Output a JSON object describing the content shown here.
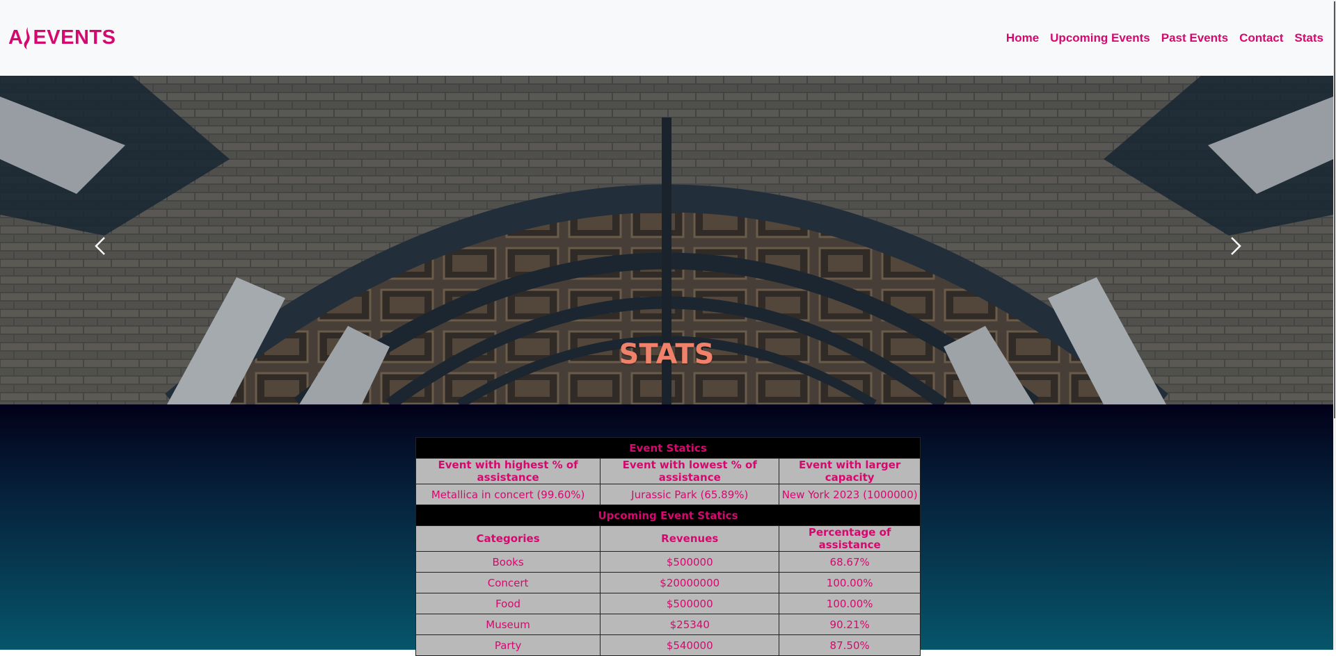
{
  "brand": {
    "name": "EVENTS",
    "logo_icon": "flame-a-icon",
    "color": "#d6086f"
  },
  "nav": {
    "items": [
      "Home",
      "Upcoming Events",
      "Past Events",
      "Contact",
      "Stats"
    ]
  },
  "hero": {
    "title": "STATS",
    "prev_icon": "chevron-left-icon",
    "next_icon": "chevron-right-icon"
  },
  "event_statics": {
    "heading": "Event Statics",
    "headers": [
      "Event with highest % of assistance",
      "Event with lowest % of assistance",
      "Event with larger capacity"
    ],
    "values": [
      "Metallica in concert (99.60%)",
      "Jurassic Park (65.89%)",
      "New York 2023 (1000000)"
    ]
  },
  "upcoming_statics": {
    "heading": "Upcoming Event Statics",
    "headers": [
      "Categories",
      "Revenues",
      "Percentage of assistance"
    ],
    "rows": [
      [
        "Books",
        "$500000",
        "68.67%"
      ],
      [
        "Concert",
        "$20000000",
        "100.00%"
      ],
      [
        "Food",
        "$500000",
        "100.00%"
      ],
      [
        "Museum",
        "$25340",
        "90.21%"
      ],
      [
        "Party",
        "$540000",
        "87.50%"
      ]
    ]
  },
  "colors": {
    "accent": "#d6086f",
    "hero_title": "#f0826c",
    "table_bg": "#b9b9b9"
  }
}
